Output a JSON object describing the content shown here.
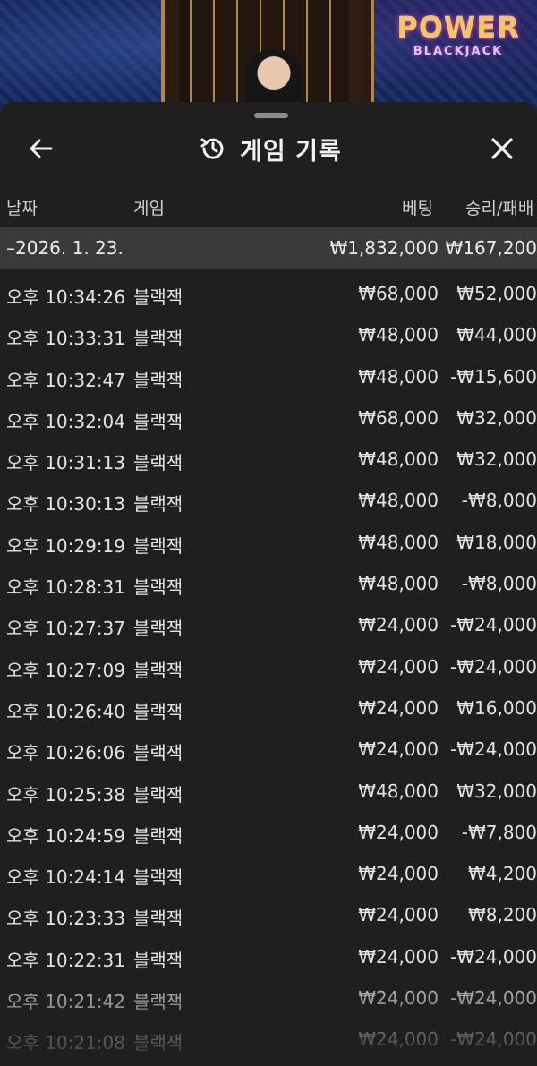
{
  "brand": {
    "main": "POWER",
    "sub": "BLACKJACK"
  },
  "header": {
    "title": "게임 기록",
    "back_icon": "arrow-left-icon",
    "history_icon": "history-icon",
    "close_icon": "close-icon"
  },
  "columns": {
    "date": "날짜",
    "game": "게임",
    "bet": "베팅",
    "win_loss": "승리/패배"
  },
  "summary": {
    "date": "–2026. 1. 23.",
    "bet": "₩1,832,000",
    "win_loss": "₩167,200"
  },
  "rows": [
    {
      "time": "오후 10:34:26",
      "game": "블랙잭",
      "bet": "₩68,000",
      "win": "₩52,000"
    },
    {
      "time": "오후 10:33:31",
      "game": "블랙잭",
      "bet": "₩48,000",
      "win": "₩44,000"
    },
    {
      "time": "오후 10:32:47",
      "game": "블랙잭",
      "bet": "₩48,000",
      "win": "-₩15,600"
    },
    {
      "time": "오후 10:32:04",
      "game": "블랙잭",
      "bet": "₩68,000",
      "win": "₩32,000"
    },
    {
      "time": "오후 10:31:13",
      "game": "블랙잭",
      "bet": "₩48,000",
      "win": "₩32,000"
    },
    {
      "time": "오후 10:30:13",
      "game": "블랙잭",
      "bet": "₩48,000",
      "win": "-₩8,000"
    },
    {
      "time": "오후 10:29:19",
      "game": "블랙잭",
      "bet": "₩48,000",
      "win": "₩18,000"
    },
    {
      "time": "오후 10:28:31",
      "game": "블랙잭",
      "bet": "₩48,000",
      "win": "-₩8,000"
    },
    {
      "time": "오후 10:27:37",
      "game": "블랙잭",
      "bet": "₩24,000",
      "win": "-₩24,000"
    },
    {
      "time": "오후 10:27:09",
      "game": "블랙잭",
      "bet": "₩24,000",
      "win": "-₩24,000"
    },
    {
      "time": "오후 10:26:40",
      "game": "블랙잭",
      "bet": "₩24,000",
      "win": "₩16,000"
    },
    {
      "time": "오후 10:26:06",
      "game": "블랙잭",
      "bet": "₩24,000",
      "win": "-₩24,000"
    },
    {
      "time": "오후 10:25:38",
      "game": "블랙잭",
      "bet": "₩48,000",
      "win": "₩32,000"
    },
    {
      "time": "오후 10:24:59",
      "game": "블랙잭",
      "bet": "₩24,000",
      "win": "-₩7,800"
    },
    {
      "time": "오후 10:24:14",
      "game": "블랙잭",
      "bet": "₩24,000",
      "win": "₩4,200"
    },
    {
      "time": "오후 10:23:33",
      "game": "블랙잭",
      "bet": "₩24,000",
      "win": "₩8,200"
    },
    {
      "time": "오후 10:22:31",
      "game": "블랙잭",
      "bet": "₩24,000",
      "win": "-₩24,000"
    },
    {
      "time": "오후 10:21:42",
      "game": "블랙잭",
      "bet": "₩24,000",
      "win": "-₩24,000"
    },
    {
      "time": "오후 10:21:08",
      "game": "블랙잭",
      "bet": "₩24,000",
      "win": "-₩24,000"
    }
  ],
  "colors": {
    "sheet_bg": "#1f1f1f",
    "summary_bg": "#3a3a3a",
    "text": "#e4e4e4",
    "brand_gold": "#f7c65a"
  }
}
